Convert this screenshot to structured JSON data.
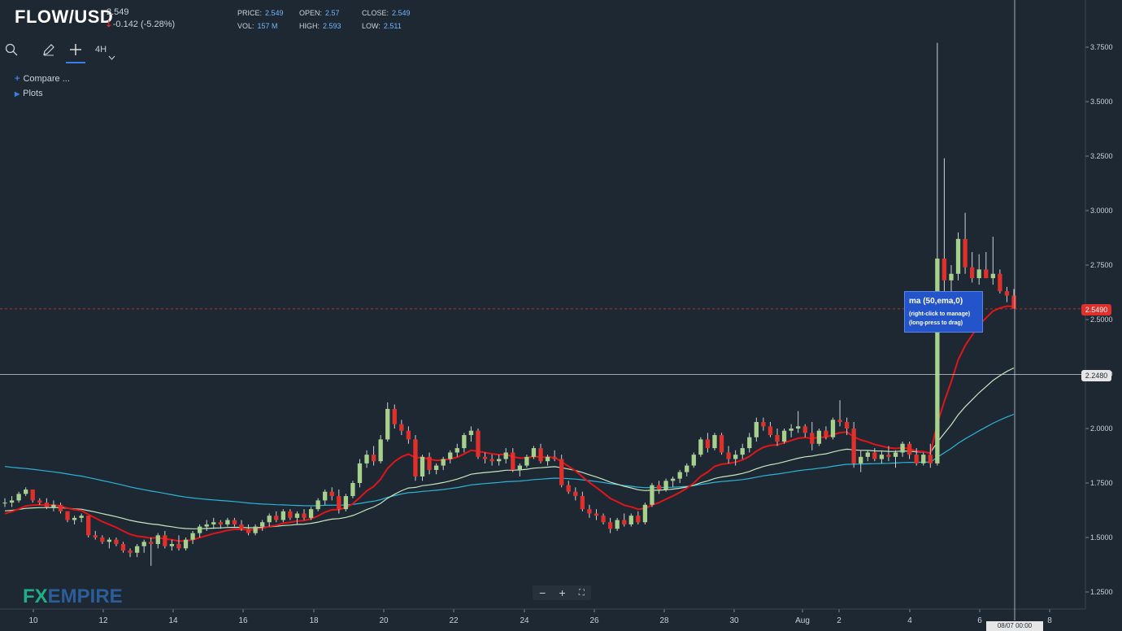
{
  "header": {
    "symbol": "FLOW/USD",
    "last_price": "2.549",
    "change": "-0.142 (-5.28%)",
    "change_icon": "arrow-down-icon"
  },
  "ohlc": {
    "price_label": "PRICE:",
    "price": "2.549",
    "open_label": "OPEN:",
    "open": "2.57",
    "close_label": "CLOSE:",
    "close": "2.549",
    "vol_label": "VOL:",
    "vol": "157 M",
    "high_label": "HIGH:",
    "high": "2.593",
    "low_label": "LOW:",
    "low": "2.511"
  },
  "toolbar": {
    "timeframe": "4H",
    "icons": [
      "search-icon",
      "pencil-icon",
      "crosshair-icon",
      "chevron-down-icon"
    ]
  },
  "menu": {
    "compare": "Compare ...",
    "plots": "Plots"
  },
  "tooltip": {
    "title": "ma (50,ema,0)",
    "line1": "(right-click to manage)",
    "line2": "(long-press to drag)"
  },
  "badges": {
    "current_price": "2.5490",
    "crosshair_price": "2.2480"
  },
  "time_label": "08/07 00:00",
  "zoom": {
    "minus": "−",
    "plus": "+",
    "fit": "⛶"
  },
  "logo": {
    "fx": "FX",
    "rest": "EMPIRE"
  },
  "colors": {
    "background": "#1e2833",
    "up": "#a8d08d",
    "down": "#e0302b",
    "ma_red": "#e0151a",
    "ma_light": "#c8e6c0",
    "ma_cyan": "#2bb5d6",
    "grid": "#2a3541"
  },
  "chart_data": {
    "type": "candlestick",
    "ylim": [
      1.2,
      3.8
    ],
    "y_ticks": [
      "1.2500",
      "1.5000",
      "1.7500",
      "2.0000",
      "2.2500",
      "2.5000",
      "2.7500",
      "3.0000",
      "3.2500",
      "3.5000",
      "3.7500"
    ],
    "x_ticks": [
      "10",
      "12",
      "14",
      "16",
      "18",
      "20",
      "22",
      "24",
      "26",
      "28",
      "30",
      "Aug",
      "2",
      "4",
      "6",
      "8"
    ],
    "current_price": 2.549,
    "crosshair_price": 2.248,
    "candles": [
      [
        1.66,
        1.68,
        1.64,
        1.66
      ],
      [
        1.66,
        1.69,
        1.64,
        1.67
      ],
      [
        1.67,
        1.71,
        1.66,
        1.7
      ],
      [
        1.7,
        1.73,
        1.69,
        1.72
      ],
      [
        1.72,
        1.72,
        1.66,
        1.67
      ],
      [
        1.67,
        1.68,
        1.65,
        1.66
      ],
      [
        1.66,
        1.68,
        1.63,
        1.64
      ],
      [
        1.64,
        1.67,
        1.62,
        1.65
      ],
      [
        1.65,
        1.66,
        1.61,
        1.62
      ],
      [
        1.62,
        1.62,
        1.57,
        1.58
      ],
      [
        1.58,
        1.6,
        1.56,
        1.59
      ],
      [
        1.59,
        1.61,
        1.57,
        1.6
      ],
      [
        1.6,
        1.6,
        1.5,
        1.51
      ],
      [
        1.51,
        1.53,
        1.49,
        1.5
      ],
      [
        1.5,
        1.51,
        1.47,
        1.48
      ],
      [
        1.48,
        1.5,
        1.45,
        1.49
      ],
      [
        1.49,
        1.5,
        1.46,
        1.47
      ],
      [
        1.47,
        1.48,
        1.43,
        1.44
      ],
      [
        1.44,
        1.45,
        1.41,
        1.43
      ],
      [
        1.43,
        1.47,
        1.41,
        1.46
      ],
      [
        1.46,
        1.49,
        1.43,
        1.48
      ],
      [
        1.48,
        1.5,
        1.37,
        1.47
      ],
      [
        1.47,
        1.52,
        1.45,
        1.51
      ],
      [
        1.51,
        1.53,
        1.45,
        1.46
      ],
      [
        1.46,
        1.49,
        1.44,
        1.47
      ],
      [
        1.47,
        1.51,
        1.44,
        1.45
      ],
      [
        1.45,
        1.5,
        1.44,
        1.49
      ],
      [
        1.49,
        1.53,
        1.47,
        1.52
      ],
      [
        1.52,
        1.56,
        1.5,
        1.55
      ],
      [
        1.55,
        1.58,
        1.53,
        1.56
      ],
      [
        1.56,
        1.59,
        1.54,
        1.57
      ],
      [
        1.57,
        1.58,
        1.54,
        1.56
      ],
      [
        1.56,
        1.59,
        1.55,
        1.58
      ],
      [
        1.58,
        1.59,
        1.55,
        1.56
      ],
      [
        1.56,
        1.58,
        1.53,
        1.54
      ],
      [
        1.54,
        1.56,
        1.51,
        1.52
      ],
      [
        1.52,
        1.56,
        1.51,
        1.55
      ],
      [
        1.55,
        1.58,
        1.53,
        1.57
      ],
      [
        1.57,
        1.61,
        1.55,
        1.6
      ],
      [
        1.6,
        1.62,
        1.57,
        1.58
      ],
      [
        1.58,
        1.63,
        1.57,
        1.62
      ],
      [
        1.62,
        1.63,
        1.58,
        1.59
      ],
      [
        1.59,
        1.62,
        1.56,
        1.61
      ],
      [
        1.61,
        1.63,
        1.58,
        1.59
      ],
      [
        1.59,
        1.64,
        1.58,
        1.63
      ],
      [
        1.63,
        1.68,
        1.62,
        1.67
      ],
      [
        1.67,
        1.72,
        1.65,
        1.71
      ],
      [
        1.71,
        1.73,
        1.67,
        1.69
      ],
      [
        1.69,
        1.72,
        1.61,
        1.63
      ],
      [
        1.63,
        1.7,
        1.62,
        1.69
      ],
      [
        1.69,
        1.76,
        1.68,
        1.75
      ],
      [
        1.75,
        1.86,
        1.73,
        1.84
      ],
      [
        1.84,
        1.9,
        1.82,
        1.88
      ],
      [
        1.88,
        1.92,
        1.83,
        1.85
      ],
      [
        1.85,
        1.97,
        1.84,
        1.95
      ],
      [
        1.95,
        2.12,
        1.94,
        2.09
      ],
      [
        2.09,
        2.11,
        2.0,
        2.02
      ],
      [
        2.02,
        2.04,
        1.97,
        1.99
      ],
      [
        1.99,
        2.01,
        1.93,
        1.95
      ],
      [
        1.95,
        1.97,
        1.76,
        1.78
      ],
      [
        1.78,
        1.88,
        1.76,
        1.87
      ],
      [
        1.87,
        1.89,
        1.79,
        1.81
      ],
      [
        1.81,
        1.84,
        1.79,
        1.83
      ],
      [
        1.83,
        1.87,
        1.81,
        1.86
      ],
      [
        1.86,
        1.9,
        1.84,
        1.89
      ],
      [
        1.89,
        1.93,
        1.87,
        1.91
      ],
      [
        1.91,
        1.98,
        1.89,
        1.97
      ],
      [
        1.97,
        2.01,
        1.94,
        1.99
      ],
      [
        1.99,
        2.0,
        1.86,
        1.87
      ],
      [
        1.87,
        1.89,
        1.84,
        1.86
      ],
      [
        1.86,
        1.88,
        1.83,
        1.85
      ],
      [
        1.85,
        1.88,
        1.83,
        1.86
      ],
      [
        1.86,
        1.91,
        1.84,
        1.89
      ],
      [
        1.89,
        1.91,
        1.8,
        1.81
      ],
      [
        1.81,
        1.84,
        1.78,
        1.83
      ],
      [
        1.83,
        1.88,
        1.82,
        1.87
      ],
      [
        1.87,
        1.92,
        1.86,
        1.91
      ],
      [
        1.91,
        1.93,
        1.84,
        1.85
      ],
      [
        1.85,
        1.88,
        1.83,
        1.87
      ],
      [
        1.87,
        1.9,
        1.85,
        1.86
      ],
      [
        1.86,
        1.88,
        1.73,
        1.74
      ],
      [
        1.74,
        1.76,
        1.7,
        1.71
      ],
      [
        1.71,
        1.73,
        1.67,
        1.69
      ],
      [
        1.69,
        1.71,
        1.62,
        1.63
      ],
      [
        1.63,
        1.65,
        1.59,
        1.61
      ],
      [
        1.61,
        1.63,
        1.58,
        1.6
      ],
      [
        1.6,
        1.61,
        1.56,
        1.57
      ],
      [
        1.57,
        1.59,
        1.52,
        1.54
      ],
      [
        1.54,
        1.59,
        1.53,
        1.58
      ],
      [
        1.58,
        1.61,
        1.55,
        1.56
      ],
      [
        1.56,
        1.61,
        1.55,
        1.6
      ],
      [
        1.6,
        1.62,
        1.56,
        1.57
      ],
      [
        1.57,
        1.66,
        1.56,
        1.65
      ],
      [
        1.65,
        1.75,
        1.64,
        1.74
      ],
      [
        1.74,
        1.76,
        1.7,
        1.72
      ],
      [
        1.72,
        1.77,
        1.71,
        1.76
      ],
      [
        1.76,
        1.78,
        1.73,
        1.77
      ],
      [
        1.77,
        1.81,
        1.75,
        1.8
      ],
      [
        1.8,
        1.84,
        1.78,
        1.83
      ],
      [
        1.83,
        1.89,
        1.82,
        1.88
      ],
      [
        1.88,
        1.96,
        1.87,
        1.95
      ],
      [
        1.95,
        1.98,
        1.89,
        1.91
      ],
      [
        1.91,
        1.98,
        1.9,
        1.97
      ],
      [
        1.97,
        1.98,
        1.88,
        1.89
      ],
      [
        1.89,
        1.92,
        1.84,
        1.86
      ],
      [
        1.86,
        1.9,
        1.83,
        1.88
      ],
      [
        1.88,
        1.93,
        1.86,
        1.91
      ],
      [
        1.91,
        1.98,
        1.89,
        1.96
      ],
      [
        1.96,
        2.05,
        1.94,
        2.03
      ],
      [
        2.03,
        2.05,
        1.99,
        2.01
      ],
      [
        2.01,
        2.03,
        1.96,
        1.97
      ],
      [
        1.97,
        2.0,
        1.92,
        1.94
      ],
      [
        1.94,
        2.0,
        1.93,
        1.99
      ],
      [
        1.99,
        2.02,
        1.96,
        2.0
      ],
      [
        2.0,
        2.08,
        1.98,
        2.01
      ],
      [
        2.01,
        2.02,
        1.96,
        1.98
      ],
      [
        1.98,
        2.03,
        1.9,
        1.93
      ],
      [
        1.93,
        2.0,
        1.92,
        1.99
      ],
      [
        1.99,
        2.01,
        1.95,
        1.96
      ],
      [
        1.96,
        2.05,
        1.95,
        2.04
      ],
      [
        2.04,
        2.13,
        2.01,
        2.03
      ],
      [
        2.03,
        2.05,
        1.97,
        2.0
      ],
      [
        2.0,
        2.03,
        1.82,
        1.84
      ],
      [
        1.84,
        1.9,
        1.8,
        1.87
      ],
      [
        1.87,
        1.9,
        1.85,
        1.89
      ],
      [
        1.89,
        1.91,
        1.85,
        1.86
      ],
      [
        1.86,
        1.9,
        1.84,
        1.88
      ],
      [
        1.88,
        1.92,
        1.85,
        1.87
      ],
      [
        1.87,
        1.9,
        1.82,
        1.89
      ],
      [
        1.89,
        1.94,
        1.87,
        1.93
      ],
      [
        1.93,
        1.94,
        1.86,
        1.88
      ],
      [
        1.88,
        1.91,
        1.83,
        1.84
      ],
      [
        1.84,
        1.89,
        1.83,
        1.88
      ],
      [
        1.88,
        1.93,
        1.82,
        1.84
      ],
      [
        1.84,
        3.77,
        1.83,
        2.78
      ],
      [
        2.78,
        3.24,
        2.55,
        2.68
      ],
      [
        2.68,
        2.75,
        2.54,
        2.71
      ],
      [
        2.71,
        2.9,
        2.68,
        2.87
      ],
      [
        2.87,
        2.99,
        2.71,
        2.74
      ],
      [
        2.74,
        2.81,
        2.67,
        2.69
      ],
      [
        2.69,
        2.8,
        2.66,
        2.73
      ],
      [
        2.73,
        2.81,
        2.7,
        2.69
      ],
      [
        2.69,
        2.88,
        2.66,
        2.71
      ],
      [
        2.71,
        2.73,
        2.62,
        2.63
      ],
      [
        2.63,
        2.65,
        2.58,
        2.61
      ],
      [
        2.61,
        2.64,
        2.56,
        2.55
      ]
    ],
    "series": [
      {
        "type": "ema",
        "period": 50,
        "color": "#e0151a"
      },
      {
        "type": "ma",
        "color": "#c8e6c0"
      },
      {
        "type": "ma",
        "color": "#2bb5d6"
      }
    ]
  }
}
